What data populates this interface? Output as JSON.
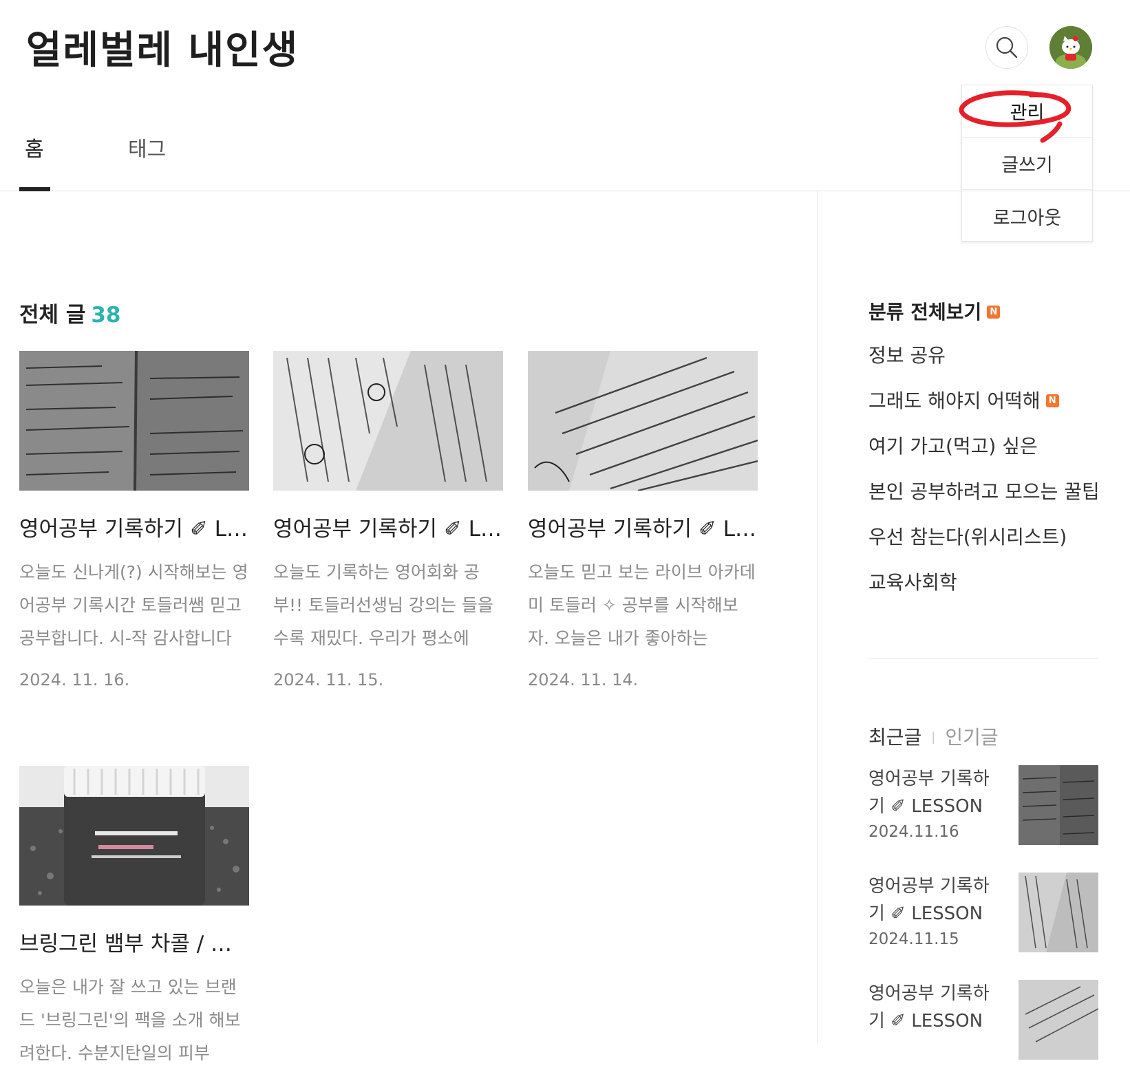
{
  "header": {
    "site_title": "얼레벌레 내인생"
  },
  "icons": {
    "search": "search-icon",
    "avatar": "hello-kitty-avatar"
  },
  "menu": {
    "items": [
      {
        "label": "관리"
      },
      {
        "label": "글쓰기"
      },
      {
        "label": "로그아웃"
      }
    ],
    "annotation_color": "#e5202a"
  },
  "tabs": [
    {
      "label": "홈",
      "active": true
    },
    {
      "label": "태그",
      "active": false
    }
  ],
  "main": {
    "section_label": "전체 글",
    "section_count": "38",
    "count_color": "#2bb3b1",
    "posts": [
      {
        "title": "영어공부 기록하기 ✐ LESSON",
        "excerpt": "오늘도 신나게(?) 시작해보는 영어공부 기록시간 토들러쌤 믿고 공부합니다. 시-작 감사합니다",
        "date": "2024. 11. 16."
      },
      {
        "title": "영어공부 기록하기 ✐ LESSON",
        "excerpt": "오늘도 기록하는 영어회화 공부!! 토들러선생님 강의는 들을수록 재밌다. 우리가 평소에",
        "date": "2024. 11. 15."
      },
      {
        "title": "영어공부 기록하기 ✐ LESSON",
        "excerpt": "오늘도 믿고 보는 라이브 아카데미 토들러 ✧ 공부를 시작해보자. 오늘은 내가 좋아하는",
        "date": "2024. 11. 14."
      },
      {
        "title": "브링그린 뱀부 차콜 / 팩 리뷰",
        "excerpt": "오늘은 내가 잘 쓰고 있는 브랜드 '브링그린'의 팩을 소개 해보려한다. 수분지탄일의 피부",
        "date": ""
      }
    ]
  },
  "sidebar": {
    "category_title": "분류 전체보기",
    "new_badge": "N",
    "categories": [
      {
        "label": "정보 공유",
        "new": false
      },
      {
        "label": "그래도 해야지 어떡해",
        "new": true
      },
      {
        "label": "여기 가고(먹고) 싶은",
        "new": false
      },
      {
        "label": "본인 공부하려고 모으는 꿀팁",
        "new": false
      },
      {
        "label": "우선 참는다(위시리스트)",
        "new": false
      },
      {
        "label": "교육사회학",
        "new": false
      }
    ],
    "recent_tab": "최근글",
    "popular_tab": "인기글",
    "separator": "|",
    "recent_posts": [
      {
        "title": "영어공부 기록하기 ✐ LESSON",
        "date": "2024.11.16"
      },
      {
        "title": "영어공부 기록하기 ✐ LESSON",
        "date": "2024.11.15"
      },
      {
        "title": "영어공부 기록하기 ✐ LESSON",
        "date": ""
      }
    ]
  }
}
